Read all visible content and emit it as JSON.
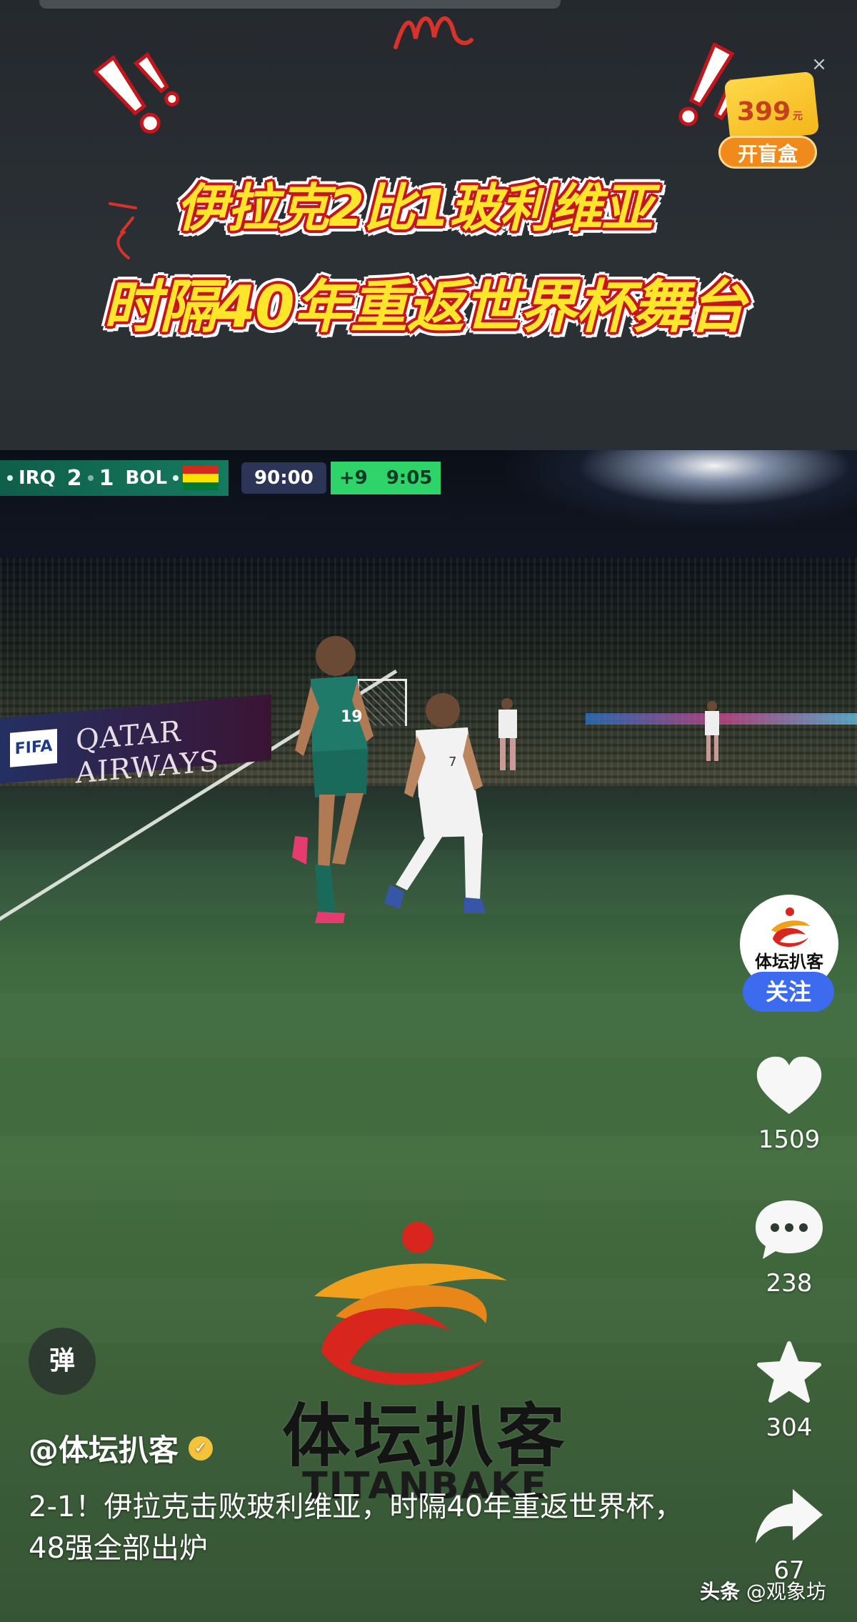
{
  "banner": {
    "headline_line1": "伊拉克2比1玻利维亚",
    "headline_line2": "时隔40年重返世界杯舞台"
  },
  "ad": {
    "price": "399",
    "currency": "元",
    "button_label": "开盲盒",
    "close_icon": "×"
  },
  "scoreboard": {
    "home_team": "IRQ",
    "home_score": "2",
    "away_score": "1",
    "away_team": "BOL",
    "match_time": "90:00",
    "added_time": "+9",
    "added_clock": "9:05"
  },
  "stadium": {
    "fifa_logo": "FIFA",
    "sponsor": "QATAR AIRWAYS"
  },
  "players": {
    "home_number": "19",
    "away_number": "7"
  },
  "watermark": {
    "brand_cn": "体坛扒客",
    "brand_en": "TITANBAKE"
  },
  "channel": {
    "avatar_text": "体坛扒客",
    "follow_label": "关注"
  },
  "actions": {
    "likes": "1509",
    "comments": "238",
    "favorites": "304",
    "shares": "67"
  },
  "danmu_label": "弹",
  "author": "@体坛扒客",
  "caption": "2-1！伊拉克击败玻利维亚，时隔40年重返世界杯，48强全部出炉",
  "source": {
    "platform": "头条",
    "account": "@观象坊"
  },
  "colors": {
    "headline_fill": "#ffe62a",
    "headline_outline": "#c4151c",
    "follow_button": "#3d6bf0",
    "scoreboard_green": "#157a5e",
    "added_time_green": "#2ed36a"
  }
}
